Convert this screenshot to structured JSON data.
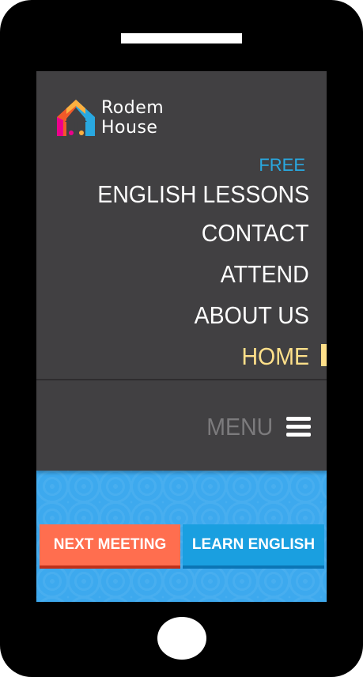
{
  "brand": {
    "line1": "Rodem",
    "line2": "House"
  },
  "nav": {
    "free": "FREE",
    "items": [
      {
        "label": "ENGLISH LESSONS"
      },
      {
        "label": "CONTACT"
      },
      {
        "label": "ATTEND"
      },
      {
        "label": "ABOUT US"
      },
      {
        "label": "HOME",
        "active": true
      }
    ]
  },
  "menu": {
    "label": "MENU"
  },
  "buttons": {
    "next_meeting": "NEXT MEETING",
    "learn_english": "LEARN ENGLISH"
  },
  "colors": {
    "nav_bg": "#414042",
    "accent_blue": "#29a8e0",
    "active": "#ffe08a",
    "meeting_button": "#ff6e4f",
    "english_button": "#1a9fe0",
    "page_bg": "#3da9ee"
  },
  "icons": {
    "logo": "house-umbrella-logo-icon",
    "menu": "hamburger-icon"
  }
}
